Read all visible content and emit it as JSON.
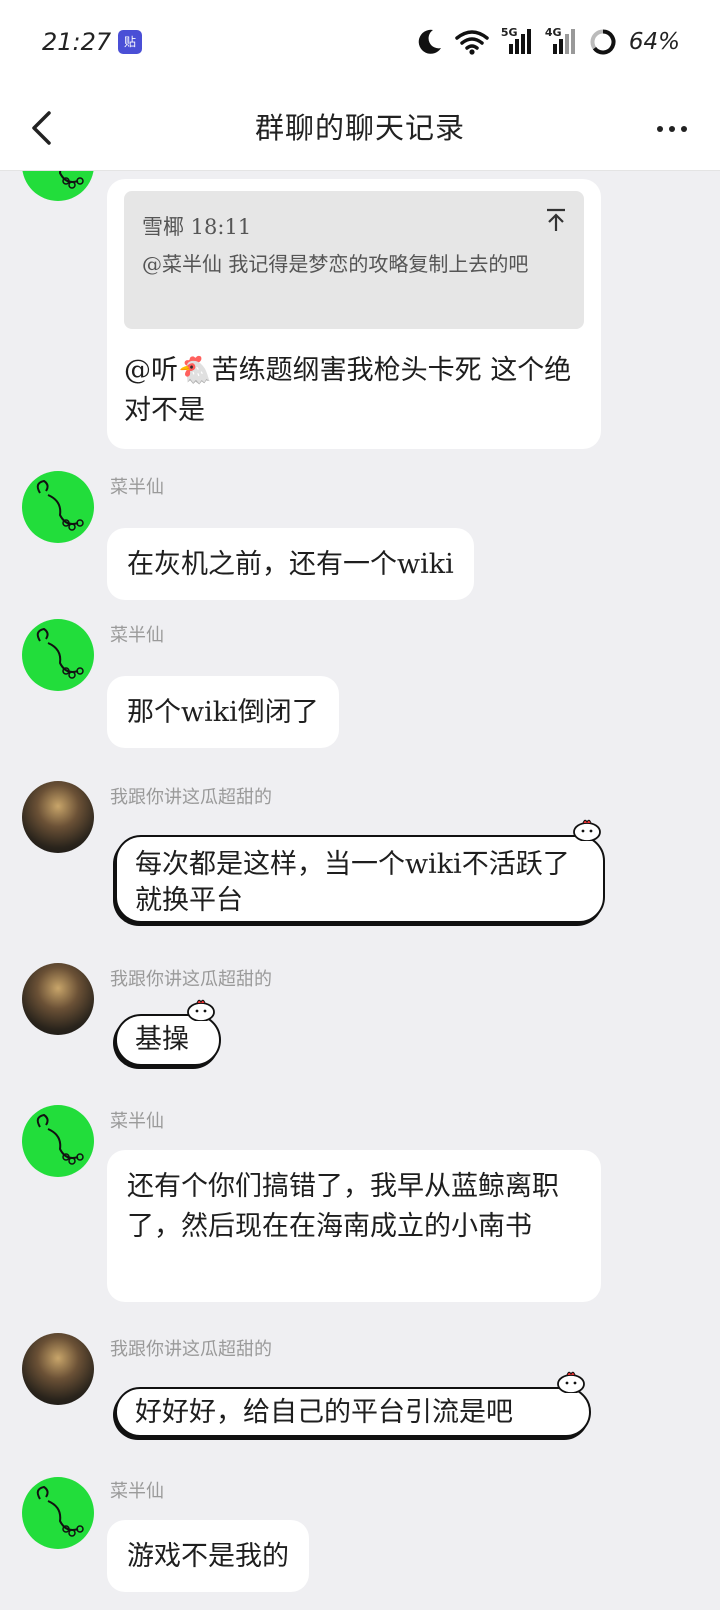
{
  "status_bar": {
    "time": "21:27",
    "app_badge": "贴",
    "network_1": "5G",
    "network_2": "4G",
    "battery": "64%"
  },
  "header": {
    "title": "群聊的聊天记录"
  },
  "messages": [
    {
      "quote_author_time": "雪椰 18:11",
      "quote_text": "@菜半仙 我记得是梦恋的攻略复制上去的吧",
      "text": "@听🐔苦练题纲害我枪头卡死 这个绝对不是"
    },
    {
      "sender": "菜半仙",
      "text": "在灰机之前，还有一个wiki"
    },
    {
      "sender": "菜半仙",
      "text": "那个wiki倒闭了"
    },
    {
      "sender": "我跟你讲这瓜超甜的",
      "text": "每次都是这样，当一个wiki不活跃了就换平台"
    },
    {
      "sender": "我跟你讲这瓜超甜的",
      "text": "基操"
    },
    {
      "sender": "菜半仙",
      "text": "还有个你们搞错了，我早从蓝鲸离职了，然后现在在海南成立的小南书"
    },
    {
      "sender": "我跟你讲这瓜超甜的",
      "text": "好好好，给自己的平台引流是吧"
    },
    {
      "sender": "菜半仙",
      "text": "游戏不是我的"
    }
  ],
  "colors": {
    "background": "#efeff2",
    "bubble": "#ffffff",
    "avatar_green": "#22dd3b",
    "sender": "#9a9a9a"
  },
  "icons": [
    "back-arrow-icon",
    "more-icon",
    "moon-icon",
    "wifi-icon",
    "signal-icon",
    "battery-icon",
    "scroll-top-icon",
    "chick-icon",
    "scorpion-avatar-icon"
  ]
}
